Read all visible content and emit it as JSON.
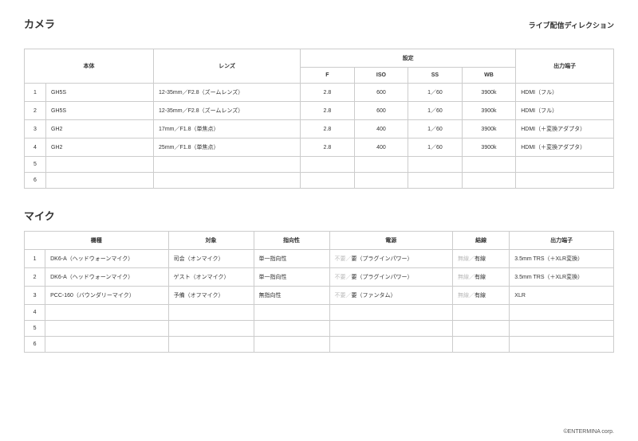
{
  "page": {
    "subtitle": "ライブ配信ディレクション",
    "footer": "©ENTERMINA corp."
  },
  "camera": {
    "title": "カメラ",
    "headers": {
      "body": "本体",
      "lens": "レンズ",
      "settings": "設定",
      "f": "F",
      "iso": "ISO",
      "ss": "SS",
      "wb": "WB",
      "out": "出力端子"
    },
    "rows": [
      {
        "idx": "1",
        "body": "GH5S",
        "lens": "12-35mm／F2.8（ズームレンズ）",
        "f": "2.8",
        "iso": "600",
        "ss": "1／60",
        "wb": "3900k",
        "out": "HDMI（フル）"
      },
      {
        "idx": "2",
        "body": "GH5S",
        "lens": "12-35mm／F2.8（ズームレンズ）",
        "f": "2.8",
        "iso": "600",
        "ss": "1／60",
        "wb": "3900k",
        "out": "HDMI（フル）"
      },
      {
        "idx": "3",
        "body": "GH2",
        "lens": "17mm／F1.8（単焦点）",
        "f": "2.8",
        "iso": "400",
        "ss": "1／60",
        "wb": "3900k",
        "out": "HDMI（＋変換アダプタ）"
      },
      {
        "idx": "4",
        "body": "GH2",
        "lens": "25mm／F1.8（単焦点）",
        "f": "2.8",
        "iso": "400",
        "ss": "1／60",
        "wb": "3900k",
        "out": "HDMI（＋変換アダプタ）"
      },
      {
        "idx": "5",
        "body": "",
        "lens": "",
        "f": "",
        "iso": "",
        "ss": "",
        "wb": "",
        "out": ""
      },
      {
        "idx": "6",
        "body": "",
        "lens": "",
        "f": "",
        "iso": "",
        "ss": "",
        "wb": "",
        "out": ""
      }
    ]
  },
  "mic": {
    "title": "マイク",
    "headers": {
      "model": "機種",
      "target": "対象",
      "dir": "指向性",
      "power": "電源",
      "wire": "結線",
      "out": "出力端子"
    },
    "option_labels": {
      "pwr_off": "不要",
      "pwr_sep": "／",
      "pwr_on_plugin": "要（プラグインパワー）",
      "pwr_on_phantom": "要（ファンタム）",
      "wire_wireless": "無線",
      "wire_sep": "／",
      "wire_wired": "有線"
    },
    "rows": [
      {
        "idx": "1",
        "model": "DK6-A（ヘッドウォーンマイク）",
        "target": "司会（オンマイク）",
        "dir": "単一指向性",
        "power_sel": "plugin",
        "wire_sel": "wired",
        "out": "3.5mm TRS（＋XLR変換）"
      },
      {
        "idx": "2",
        "model": "DK6-A（ヘッドウォーンマイク）",
        "target": "ゲスト（オンマイク）",
        "dir": "単一指向性",
        "power_sel": "plugin",
        "wire_sel": "wired",
        "out": "3.5mm TRS（＋XLR変換）"
      },
      {
        "idx": "3",
        "model": "PCC-160（バウンダリーマイク）",
        "target": "予備（オフマイク）",
        "dir": "無指向性",
        "power_sel": "phantom",
        "wire_sel": "wired",
        "out": "XLR"
      },
      {
        "idx": "4",
        "model": "",
        "target": "",
        "dir": "",
        "power_sel": "",
        "wire_sel": "",
        "out": ""
      },
      {
        "idx": "5",
        "model": "",
        "target": "",
        "dir": "",
        "power_sel": "",
        "wire_sel": "",
        "out": ""
      },
      {
        "idx": "6",
        "model": "",
        "target": "",
        "dir": "",
        "power_sel": "",
        "wire_sel": "",
        "out": ""
      }
    ]
  }
}
